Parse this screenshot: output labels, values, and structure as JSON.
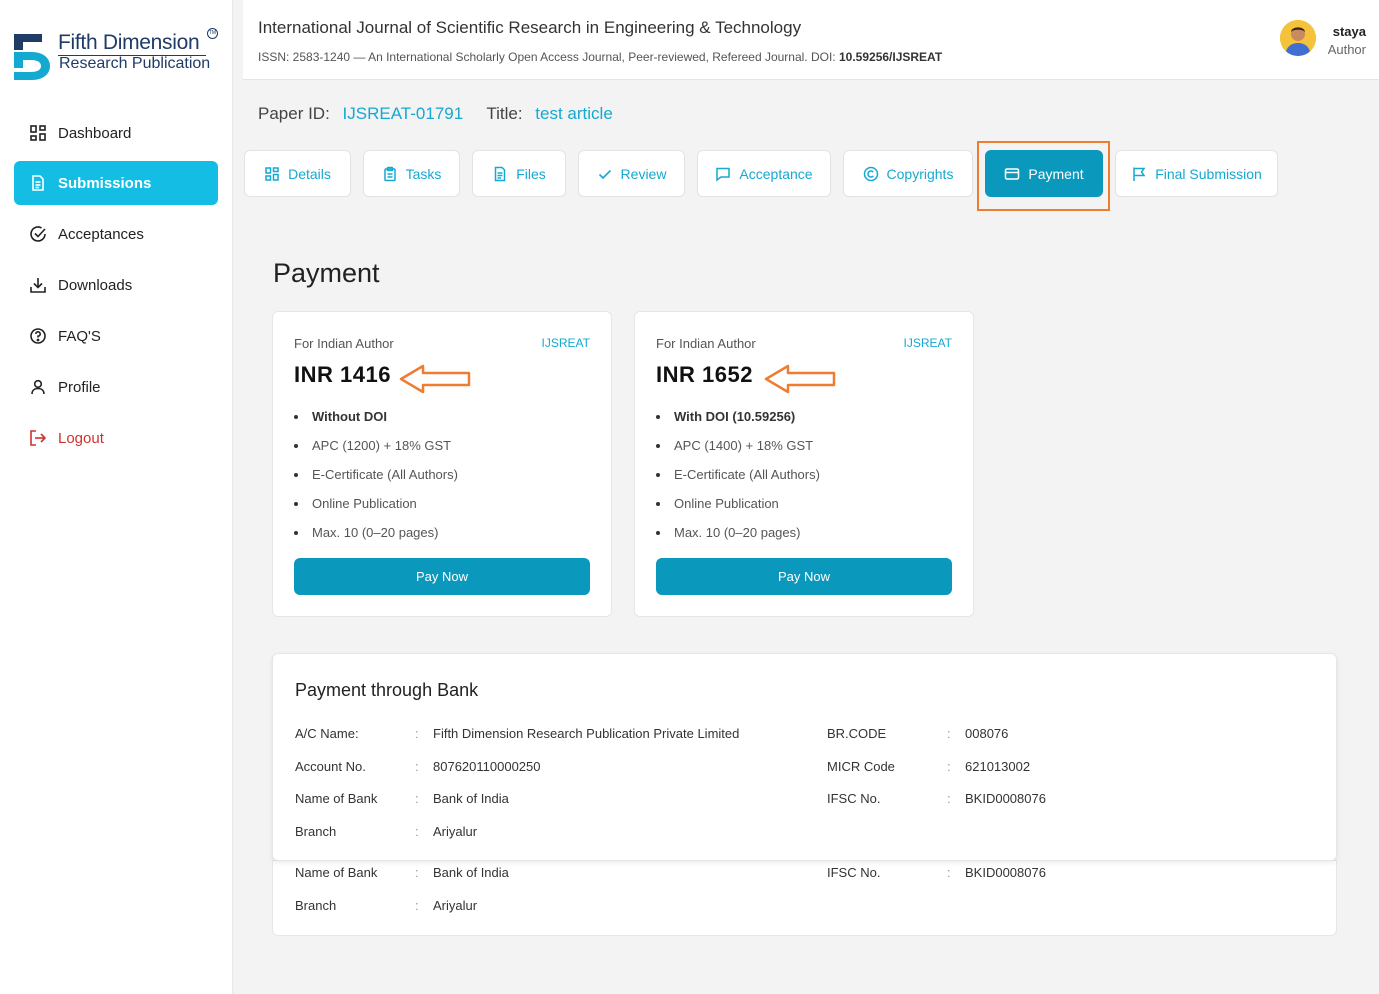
{
  "brand": {
    "name": "Fifth Dimension",
    "sub": "Research Publication",
    "tm": "TM"
  },
  "sidebar": {
    "items": [
      {
        "label": "Dashboard",
        "icon": "grid-icon"
      },
      {
        "label": "Submissions",
        "icon": "document-icon"
      },
      {
        "label": "Acceptances",
        "icon": "check-circle-icon"
      },
      {
        "label": "Downloads",
        "icon": "download-icon"
      },
      {
        "label": "FAQ'S",
        "icon": "question-icon"
      },
      {
        "label": "Profile",
        "icon": "user-icon"
      },
      {
        "label": "Logout",
        "icon": "logout-icon"
      }
    ]
  },
  "header": {
    "title": "International Journal of Scientific Research in Engineering & Technology",
    "subtitle": "ISSN: 2583-1240 — An International Scholarly Open Access Journal, Peer-reviewed, Refereed Journal. DOI: ",
    "doi": "10.59256/IJSREAT",
    "user_name": "staya",
    "user_role": "Author"
  },
  "paper": {
    "id_label": "Paper ID:",
    "id_value": "IJSREAT-01791",
    "title_label": "Title:",
    "title_value": "test article"
  },
  "tabs": [
    {
      "label": "Details",
      "icon": "grid-icon"
    },
    {
      "label": "Tasks",
      "icon": "clipboard-icon"
    },
    {
      "label": "Files",
      "icon": "file-icon"
    },
    {
      "label": "Review",
      "icon": "check-icon"
    },
    {
      "label": "Acceptance",
      "icon": "message-icon"
    },
    {
      "label": "Copyrights",
      "icon": "copyright-icon"
    },
    {
      "label": "Payment",
      "icon": "credit-card-icon"
    },
    {
      "label": "Final Submission",
      "icon": "flag-icon"
    }
  ],
  "section_title": "Payment",
  "cards": [
    {
      "for": "For Indian Author",
      "brand": "IJSREAT",
      "price": "INR 1416",
      "features": [
        "Without DOI",
        "APC (1200) + 18% GST",
        "E-Certificate (All Authors)",
        "Online Publication",
        "Max. 10 (0–20 pages)"
      ],
      "button": "Pay Now"
    },
    {
      "for": "For Indian Author",
      "brand": "IJSREAT",
      "price": "INR 1652",
      "features": [
        "With DOI (10.59256)",
        "APC (1400) + 18% GST",
        "E-Certificate (All Authors)",
        "Online Publication",
        "Max. 10 (0–20 pages)"
      ],
      "button": "Pay Now"
    }
  ],
  "bank": {
    "title": "Payment through Bank",
    "sep": ":",
    "left": [
      {
        "key": "A/C Name:",
        "value": "Fifth Dimension Research Publication Private Limited"
      },
      {
        "key": "Account No.",
        "value": "807620110000250"
      },
      {
        "key": "Name of Bank",
        "value": "Bank of India"
      },
      {
        "key": "Branch",
        "value": "Ariyalur"
      }
    ],
    "right": [
      {
        "key": "BR.CODE",
        "value": "008076"
      },
      {
        "key": "MICR Code",
        "value": "621013002"
      },
      {
        "key": "IFSC No.",
        "value": "BKID0008076"
      }
    ],
    "duplicate": {
      "left": [
        {
          "key": "Name of Bank",
          "value": "Bank of India"
        },
        {
          "key": "Branch",
          "value": "Ariyalur"
        }
      ],
      "right": [
        {
          "key": "IFSC No.",
          "value": "BKID0008076"
        }
      ]
    }
  },
  "colors": {
    "accent": "#14bde3",
    "button": "#0b98bd",
    "link": "#14a9d1",
    "logout": "#d0322e",
    "annotation": "#ef7d31"
  }
}
